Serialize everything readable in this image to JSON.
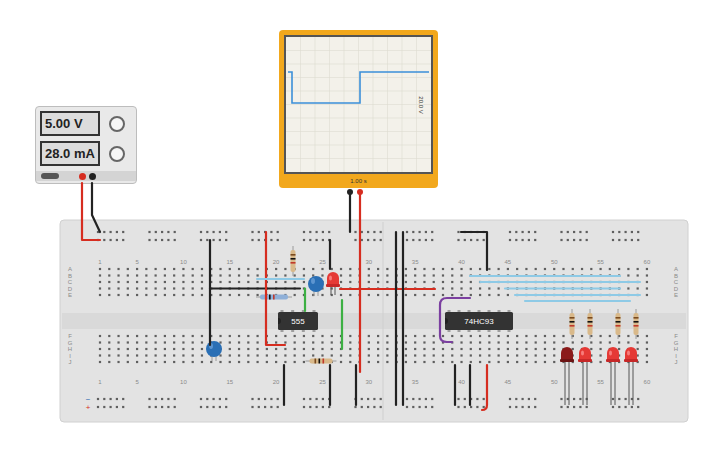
{
  "power_supply": {
    "voltage": "5.00 V",
    "current": "28.0 mA"
  },
  "oscilloscope": {
    "volts_per_div": "20.0 V",
    "time_per_div": "1.00 s",
    "trace": [
      5,
      0,
      0,
      0,
      0,
      0,
      0,
      0,
      0,
      0,
      0,
      0,
      0,
      0,
      0,
      0,
      0,
      0,
      5,
      5,
      5,
      5,
      5,
      5,
      5,
      5,
      5,
      5,
      5,
      5,
      5,
      5,
      5,
      5,
      5,
      5
    ]
  },
  "breadboard": {
    "columns": [
      "1",
      "5",
      "10",
      "15",
      "20",
      "25",
      "30",
      "35",
      "40",
      "45",
      "50",
      "55",
      "60"
    ],
    "rows_top": [
      "A",
      "B",
      "C",
      "D",
      "E"
    ],
    "rows_bottom": [
      "F",
      "G",
      "H",
      "I",
      "J"
    ],
    "rails": [
      {
        "sign": "−",
        "color": "#2b6cb0"
      },
      {
        "sign": "+",
        "color": "#d62d20"
      }
    ]
  },
  "chips": [
    {
      "label": "555"
    },
    {
      "label": "74HC93"
    }
  ],
  "leds": [
    {
      "on": true
    },
    {
      "on": false
    },
    {
      "on": true
    },
    {
      "on": true
    },
    {
      "on": true
    }
  ],
  "wires": [
    {
      "color": "#d62d20"
    },
    {
      "color": "#222222"
    },
    {
      "color": "#222222"
    },
    {
      "color": "#d62d20"
    },
    {
      "color": "#222222"
    },
    {
      "color": "#222222"
    },
    {
      "color": "#d62d20"
    },
    {
      "color": "#222222"
    },
    {
      "color": "#d62d20"
    },
    {
      "color": "#d62d20"
    },
    {
      "color": "#3cb043"
    },
    {
      "color": "#3cb043"
    },
    {
      "color": "#8ecae6"
    },
    {
      "color": "#8ecae6"
    },
    {
      "color": "#8ecae6"
    },
    {
      "color": "#8ecae6"
    },
    {
      "color": "#8ecae6"
    },
    {
      "color": "#8ecae6"
    },
    {
      "color": "#7b3fa0"
    },
    {
      "color": "#222222"
    },
    {
      "color": "#222222"
    },
    {
      "color": "#222222"
    },
    {
      "color": "#222222"
    },
    {
      "color": "#222222"
    },
    {
      "color": "#d62d20"
    },
    {
      "color": "#222222"
    },
    {
      "color": "#222222"
    },
    {
      "color": "#222222"
    }
  ]
}
